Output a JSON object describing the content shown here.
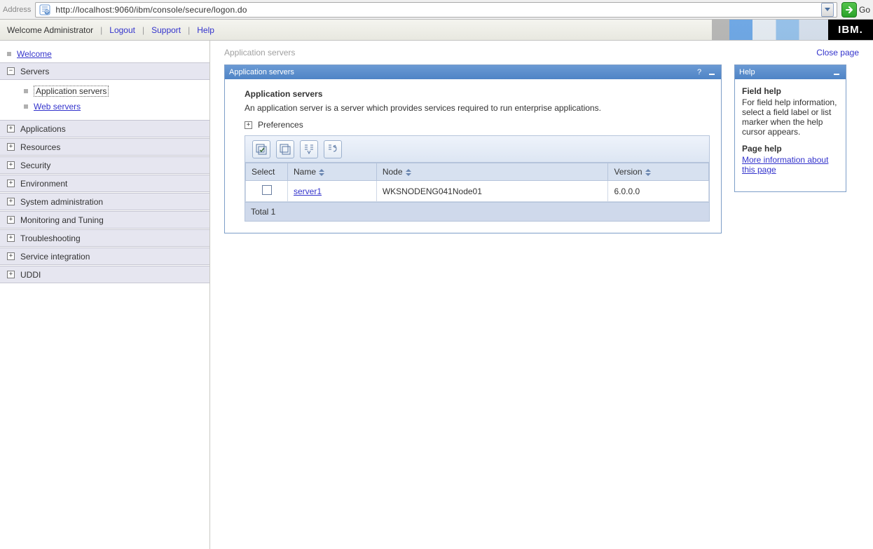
{
  "address": {
    "label": "Address",
    "url": "http://localhost:9060/ibm/console/secure/logon.do",
    "go_label": "Go"
  },
  "header": {
    "welcome": "Welcome Administrator",
    "links": {
      "logout": "Logout",
      "support": "Support",
      "help": "Help"
    },
    "logo": "IBM."
  },
  "sidebar": {
    "welcome": "Welcome",
    "servers": {
      "label": "Servers",
      "items": [
        {
          "label": "Application servers",
          "current": true
        },
        {
          "label": "Web servers",
          "current": false
        }
      ]
    },
    "sections": [
      "Applications",
      "Resources",
      "Security",
      "Environment",
      "System administration",
      "Monitoring and Tuning",
      "Troubleshooting",
      "Service integration",
      "UDDI"
    ]
  },
  "page": {
    "breadcrumb": "Application servers",
    "close": "Close page"
  },
  "portlet": {
    "title": "Application servers",
    "heading": "Application servers",
    "description": "An application server is a server which provides services required to run enterprise applications.",
    "preferences": "Preferences"
  },
  "toolbar": {
    "select_all": "select-all-icon",
    "deselect_all": "deselect-all-icon",
    "filter": "filter-icon",
    "clear_filter": "clear-filter-icon"
  },
  "table": {
    "columns": {
      "select": "Select",
      "name": "Name",
      "node": "Node",
      "version": "Version"
    },
    "rows": [
      {
        "name": "server1",
        "node": "WKSNODENG041Node01",
        "version": "6.0.0.0"
      }
    ],
    "footer": "Total 1"
  },
  "help": {
    "title": "Help",
    "field_title": "Field help",
    "field_text": "For field help information, select a field label or list marker when the help cursor appears.",
    "page_title": "Page help",
    "page_link": "More information about this page"
  }
}
